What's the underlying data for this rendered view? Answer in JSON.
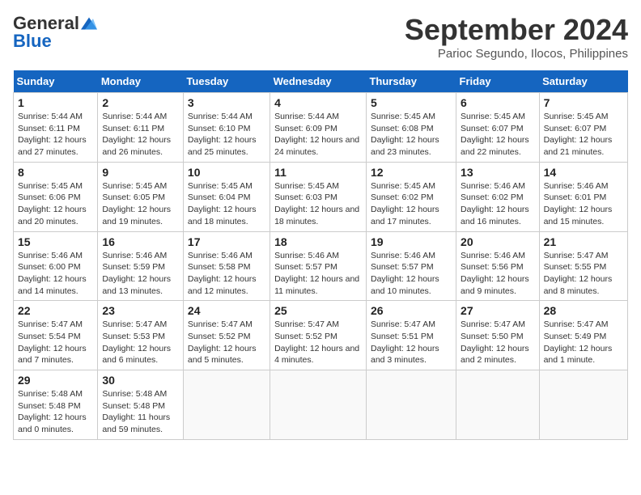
{
  "header": {
    "logo_general": "General",
    "logo_blue": "Blue",
    "month_title": "September 2024",
    "location": "Parioc Segundo, Ilocos, Philippines"
  },
  "weekdays": [
    "Sunday",
    "Monday",
    "Tuesday",
    "Wednesday",
    "Thursday",
    "Friday",
    "Saturday"
  ],
  "weeks": [
    [
      {
        "day": "1",
        "sunrise": "5:44 AM",
        "sunset": "6:11 PM",
        "daylight": "12 hours and 27 minutes."
      },
      {
        "day": "2",
        "sunrise": "5:44 AM",
        "sunset": "6:11 PM",
        "daylight": "12 hours and 26 minutes."
      },
      {
        "day": "3",
        "sunrise": "5:44 AM",
        "sunset": "6:10 PM",
        "daylight": "12 hours and 25 minutes."
      },
      {
        "day": "4",
        "sunrise": "5:44 AM",
        "sunset": "6:09 PM",
        "daylight": "12 hours and 24 minutes."
      },
      {
        "day": "5",
        "sunrise": "5:45 AM",
        "sunset": "6:08 PM",
        "daylight": "12 hours and 23 minutes."
      },
      {
        "day": "6",
        "sunrise": "5:45 AM",
        "sunset": "6:07 PM",
        "daylight": "12 hours and 22 minutes."
      },
      {
        "day": "7",
        "sunrise": "5:45 AM",
        "sunset": "6:07 PM",
        "daylight": "12 hours and 21 minutes."
      }
    ],
    [
      {
        "day": "8",
        "sunrise": "5:45 AM",
        "sunset": "6:06 PM",
        "daylight": "12 hours and 20 minutes."
      },
      {
        "day": "9",
        "sunrise": "5:45 AM",
        "sunset": "6:05 PM",
        "daylight": "12 hours and 19 minutes."
      },
      {
        "day": "10",
        "sunrise": "5:45 AM",
        "sunset": "6:04 PM",
        "daylight": "12 hours and 18 minutes."
      },
      {
        "day": "11",
        "sunrise": "5:45 AM",
        "sunset": "6:03 PM",
        "daylight": "12 hours and 18 minutes."
      },
      {
        "day": "12",
        "sunrise": "5:45 AM",
        "sunset": "6:02 PM",
        "daylight": "12 hours and 17 minutes."
      },
      {
        "day": "13",
        "sunrise": "5:46 AM",
        "sunset": "6:02 PM",
        "daylight": "12 hours and 16 minutes."
      },
      {
        "day": "14",
        "sunrise": "5:46 AM",
        "sunset": "6:01 PM",
        "daylight": "12 hours and 15 minutes."
      }
    ],
    [
      {
        "day": "15",
        "sunrise": "5:46 AM",
        "sunset": "6:00 PM",
        "daylight": "12 hours and 14 minutes."
      },
      {
        "day": "16",
        "sunrise": "5:46 AM",
        "sunset": "5:59 PM",
        "daylight": "12 hours and 13 minutes."
      },
      {
        "day": "17",
        "sunrise": "5:46 AM",
        "sunset": "5:58 PM",
        "daylight": "12 hours and 12 minutes."
      },
      {
        "day": "18",
        "sunrise": "5:46 AM",
        "sunset": "5:57 PM",
        "daylight": "12 hours and 11 minutes."
      },
      {
        "day": "19",
        "sunrise": "5:46 AM",
        "sunset": "5:57 PM",
        "daylight": "12 hours and 10 minutes."
      },
      {
        "day": "20",
        "sunrise": "5:46 AM",
        "sunset": "5:56 PM",
        "daylight": "12 hours and 9 minutes."
      },
      {
        "day": "21",
        "sunrise": "5:47 AM",
        "sunset": "5:55 PM",
        "daylight": "12 hours and 8 minutes."
      }
    ],
    [
      {
        "day": "22",
        "sunrise": "5:47 AM",
        "sunset": "5:54 PM",
        "daylight": "12 hours and 7 minutes."
      },
      {
        "day": "23",
        "sunrise": "5:47 AM",
        "sunset": "5:53 PM",
        "daylight": "12 hours and 6 minutes."
      },
      {
        "day": "24",
        "sunrise": "5:47 AM",
        "sunset": "5:52 PM",
        "daylight": "12 hours and 5 minutes."
      },
      {
        "day": "25",
        "sunrise": "5:47 AM",
        "sunset": "5:52 PM",
        "daylight": "12 hours and 4 minutes."
      },
      {
        "day": "26",
        "sunrise": "5:47 AM",
        "sunset": "5:51 PM",
        "daylight": "12 hours and 3 minutes."
      },
      {
        "day": "27",
        "sunrise": "5:47 AM",
        "sunset": "5:50 PM",
        "daylight": "12 hours and 2 minutes."
      },
      {
        "day": "28",
        "sunrise": "5:47 AM",
        "sunset": "5:49 PM",
        "daylight": "12 hours and 1 minute."
      }
    ],
    [
      {
        "day": "29",
        "sunrise": "5:48 AM",
        "sunset": "5:48 PM",
        "daylight": "12 hours and 0 minutes."
      },
      {
        "day": "30",
        "sunrise": "5:48 AM",
        "sunset": "5:48 PM",
        "daylight": "11 hours and 59 minutes."
      },
      null,
      null,
      null,
      null,
      null
    ]
  ]
}
